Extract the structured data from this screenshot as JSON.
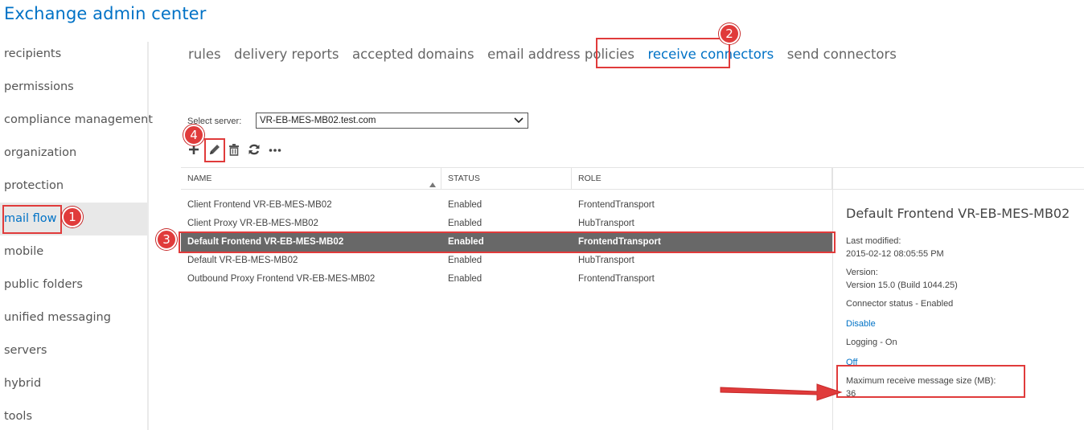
{
  "app": {
    "title": "Exchange admin center"
  },
  "sidebar": {
    "items": [
      {
        "label": "recipients",
        "selected": false
      },
      {
        "label": "permissions",
        "selected": false
      },
      {
        "label": "compliance management",
        "selected": false
      },
      {
        "label": "organization",
        "selected": false
      },
      {
        "label": "protection",
        "selected": false
      },
      {
        "label": "mail flow",
        "selected": true
      },
      {
        "label": "mobile",
        "selected": false
      },
      {
        "label": "public folders",
        "selected": false
      },
      {
        "label": "unified messaging",
        "selected": false
      },
      {
        "label": "servers",
        "selected": false
      },
      {
        "label": "hybrid",
        "selected": false
      },
      {
        "label": "tools",
        "selected": false
      }
    ]
  },
  "tabs": [
    {
      "label": "rules",
      "active": false
    },
    {
      "label": "delivery reports",
      "active": false
    },
    {
      "label": "accepted domains",
      "active": false
    },
    {
      "label": "email address policies",
      "active": false
    },
    {
      "label": "receive connectors",
      "active": true
    },
    {
      "label": "send connectors",
      "active": false
    }
  ],
  "server_select": {
    "label": "Select server:",
    "value": "VR-EB-MES-MB02.test.com"
  },
  "toolbar": {
    "icons": [
      "add-icon",
      "edit-icon",
      "delete-icon",
      "refresh-icon",
      "more-icon"
    ]
  },
  "grid": {
    "columns": [
      "NAME",
      "STATUS",
      "ROLE"
    ],
    "sort_icon": "sort-ascending-icon",
    "rows": [
      {
        "name": "Client Frontend VR-EB-MES-MB02",
        "status": "Enabled",
        "role": "FrontendTransport",
        "selected": false
      },
      {
        "name": "Client Proxy VR-EB-MES-MB02",
        "status": "Enabled",
        "role": "HubTransport",
        "selected": false
      },
      {
        "name": "Default Frontend VR-EB-MES-MB02",
        "status": "Enabled",
        "role": "FrontendTransport",
        "selected": true
      },
      {
        "name": "Default VR-EB-MES-MB02",
        "status": "Enabled",
        "role": "HubTransport",
        "selected": false
      },
      {
        "name": "Outbound Proxy Frontend VR-EB-MES-MB02",
        "status": "Enabled",
        "role": "FrontendTransport",
        "selected": false
      }
    ]
  },
  "details": {
    "title": "Default Frontend VR-EB-MES-MB02",
    "last_modified_label": "Last modified:",
    "last_modified_value": "2015-02-12 08:05:55 PM",
    "version_label": "Version:",
    "version_value": "Version 15.0 (Build 1044.25)",
    "connector_status": "Connector status - Enabled",
    "disable_link": "Disable",
    "logging": "Logging - On",
    "off_link": "Off",
    "max_size_label": "Maximum receive message size (MB):",
    "max_size_value": "36"
  },
  "annotations": {
    "badges": [
      "1",
      "2",
      "3",
      "4"
    ],
    "color": "#e03b3b"
  }
}
